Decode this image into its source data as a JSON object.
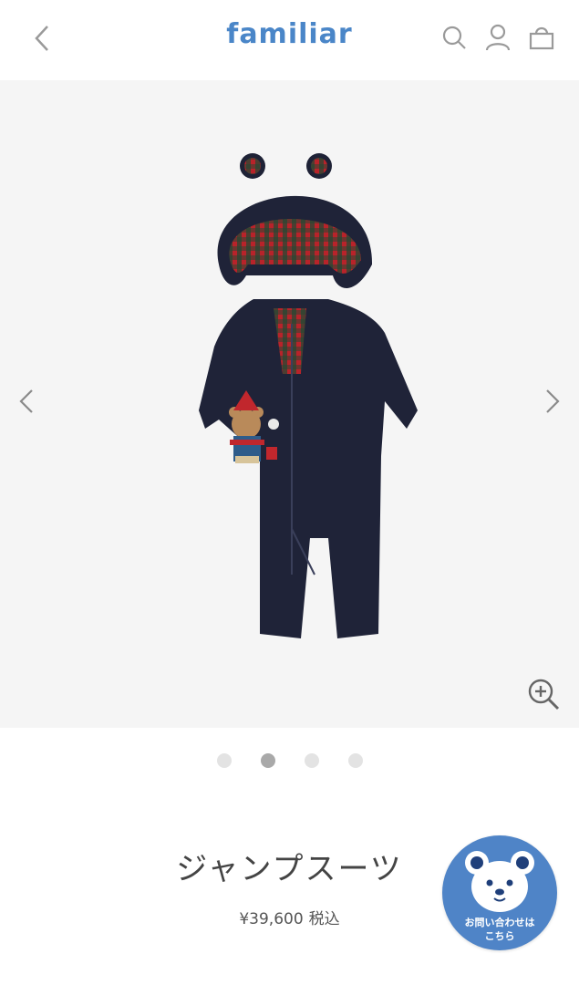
{
  "header": {
    "logo_text": "familiar",
    "colors": {
      "logo": "#4a86c8",
      "icons": "#9a9a9a"
    }
  },
  "gallery": {
    "slide_count": 4,
    "active_index": 1
  },
  "product": {
    "name": "ジャンプスーツ",
    "price": "¥39,600",
    "tax_label": "税込"
  },
  "contact": {
    "label_line1": "お問い合わせは",
    "label_line2": "こちら"
  },
  "icons": [
    "chevron-left-icon",
    "search-icon",
    "account-icon",
    "shopping-bag-icon",
    "zoom-in-icon",
    "chevron-right-icon",
    "bear-icon"
  ]
}
